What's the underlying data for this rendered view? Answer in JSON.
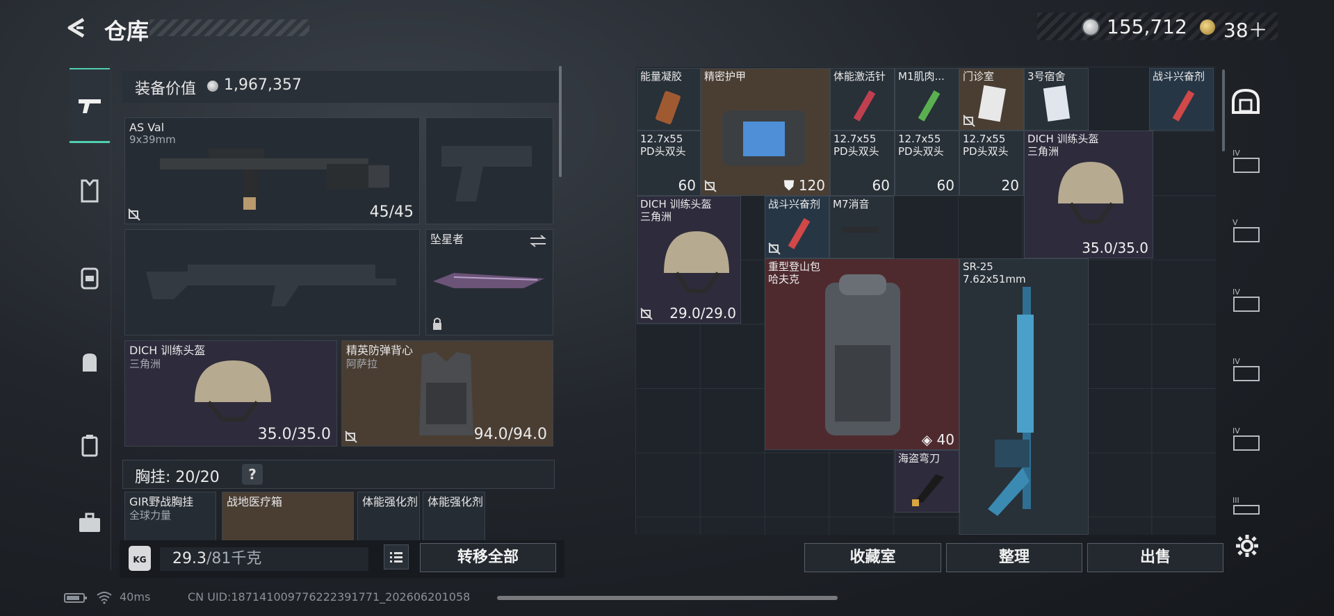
{
  "header": {
    "title": "仓库",
    "currency1": "155,712",
    "currency2": "38＋"
  },
  "left": {
    "equip_value_label": "装备价值",
    "equip_value": "1,967,357",
    "primary": {
      "name": "AS Val",
      "ammo": "9x39mm",
      "value": "45/45"
    },
    "melee": {
      "name": "坠星者"
    },
    "helmet": {
      "name": "DICH 训练头盔",
      "sub": "三角洲",
      "value": "35.0/35.0"
    },
    "armor": {
      "name": "精英防弹背心",
      "sub": "阿萨拉",
      "value": "94.0/94.0"
    },
    "rig": {
      "label": "胸挂: 20/20",
      "help": "?"
    },
    "rig_items": [
      {
        "name": "GIR野战胸挂",
        "sub": "全球力量"
      },
      {
        "name": "战地医疗箱"
      },
      {
        "name": "体能强化剂"
      },
      {
        "name": "体能强化剂"
      }
    ],
    "weight": {
      "current": "29.3",
      "cap": "/81千克"
    },
    "kg_icon": "KG",
    "transfer_all": "转移全部"
  },
  "grid_items": [
    {
      "name": "能量凝胶",
      "color": "gray"
    },
    {
      "name": "精密护甲",
      "color": "brown",
      "value": "120"
    },
    {
      "name": "体能激活针",
      "color": "gray"
    },
    {
      "name": "M1肌肉...",
      "color": "gray"
    },
    {
      "name": "门诊室",
      "color": "brown"
    },
    {
      "name": "3号宿舍",
      "color": "gray"
    },
    {
      "name": "战斗兴奋剂",
      "color": "blue"
    },
    {
      "name": "12.7x55",
      "sub": "PD头双头",
      "value": "60",
      "color": "gray"
    },
    {
      "name": "12.7x55",
      "sub": "PD头双头",
      "value": "60",
      "color": "gray"
    },
    {
      "name": "12.7x55",
      "sub": "PD头双头",
      "value": "60",
      "color": "gray"
    },
    {
      "name": "12.7x55",
      "sub": "PD头双头",
      "value": "20",
      "color": "gray"
    },
    {
      "name": "DICH 训练头盔",
      "sub": "三角洲",
      "value": "35.0/35.0",
      "color": "purple"
    },
    {
      "name": "DICH 训练头盔",
      "sub": "三角洲",
      "value": "29.0/29.0",
      "color": "purple"
    },
    {
      "name": "战斗兴奋剂",
      "color": "blue"
    },
    {
      "name": "M7消音",
      "color": "gray"
    },
    {
      "name": "重型登山包",
      "sub": "哈夫克",
      "value": "40",
      "color": "red"
    },
    {
      "name": "SR-25",
      "sub": "7.62x51mm",
      "color": "gray"
    },
    {
      "name": "海盗弯刀",
      "color": "purple"
    }
  ],
  "actions": {
    "collection": "收藏室",
    "sort": "整理",
    "sell": "出售"
  },
  "footer": {
    "ping": "40ms",
    "uid": "CN UID:18714100977622239177​1_202606201058"
  }
}
